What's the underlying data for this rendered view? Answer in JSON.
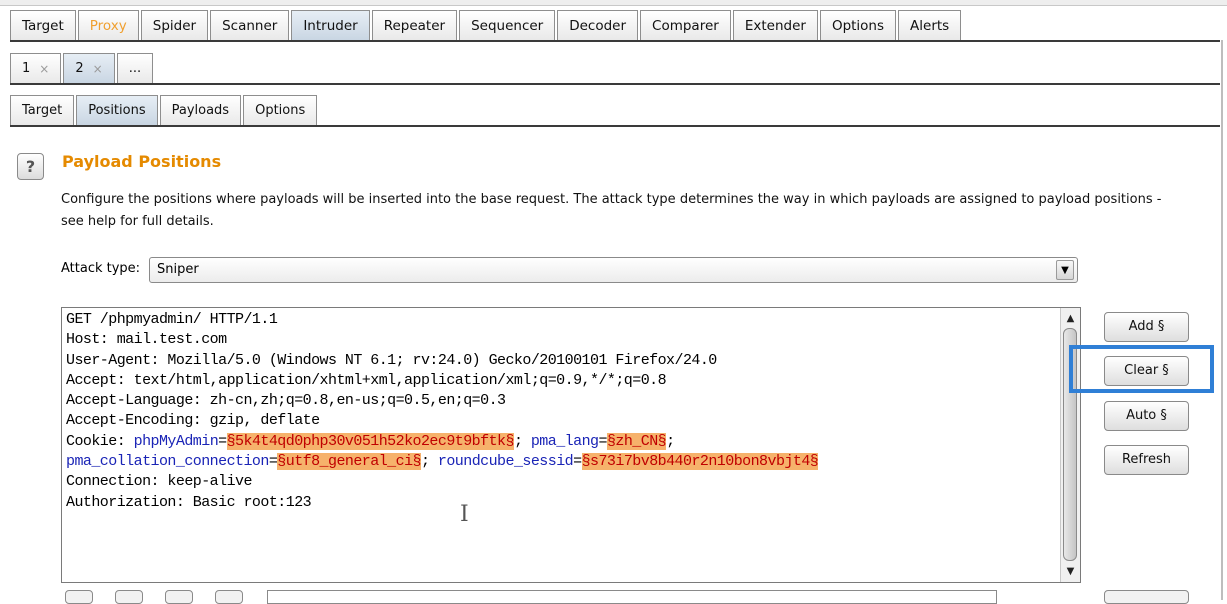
{
  "main_tabs": [
    "Target",
    "Proxy",
    "Spider",
    "Scanner",
    "Intruder",
    "Repeater",
    "Sequencer",
    "Decoder",
    "Comparer",
    "Extender",
    "Options",
    "Alerts"
  ],
  "attack_tabs": [
    {
      "label": "1",
      "close": "×"
    },
    {
      "label": "2",
      "close": "×"
    },
    {
      "label": "..."
    }
  ],
  "intruder_tabs": [
    "Target",
    "Positions",
    "Payloads",
    "Options"
  ],
  "help_icon": "?",
  "title": "Payload Positions",
  "description": "Configure the positions where payloads will be inserted into the base request. The attack type determines the way in which payloads are assigned to payload positions - see help for full details.",
  "attack_type": {
    "label": "Attack type:",
    "value": "Sniper"
  },
  "request_lines": [
    "GET /phpmyadmin/ HTTP/1.1",
    "Host: mail.test.com",
    "User-Agent: Mozilla/5.0 (Windows NT 6.1; rv:24.0) Gecko/20100101 Firefox/24.0",
    "Accept: text/html,application/xhtml+xml,application/xml;q=0.9,*/*;q=0.8",
    "Accept-Language: zh-cn,zh;q=0.8,en-us;q=0.5,en;q=0.3",
    "Accept-Encoding: gzip, deflate"
  ],
  "cookie_line1": {
    "prefix": "Cookie: ",
    "k1": "phpMyAdmin",
    "eq1": "=",
    "v1": "§5k4t4qd0php30v051h52ko2ec9t9bftk§",
    "sep1": "; ",
    "k2": "pma_lang",
    "eq2": "=",
    "v2": "§zh_CN§",
    "end": ";"
  },
  "cookie_line2": {
    "k3": "pma_collation_connection",
    "eq3": "=",
    "v3": "§utf8_general_ci§",
    "sep3": "; ",
    "k4": "roundcube_sessid",
    "eq4": "=",
    "v4": "§s73i7bv8b440r2n10bon8vbjt4§"
  },
  "request_tail": [
    "Connection: keep-alive",
    "Authorization: Basic root:123"
  ],
  "buttons": {
    "add": "Add §",
    "clear": "Clear §",
    "auto": "Auto §",
    "refresh": "Refresh"
  },
  "scroll_up": "▲",
  "scroll_down": "▼",
  "dropdown_arrow": "▼",
  "text_cursor": "I",
  "colors": {
    "accent_orange": "#e58a00",
    "highlight_box": "#2f7fd6",
    "payload_marker_bg": "#f6b26b",
    "payload_marker_text": "#c00000",
    "cookie_key": "#1a24b6"
  }
}
